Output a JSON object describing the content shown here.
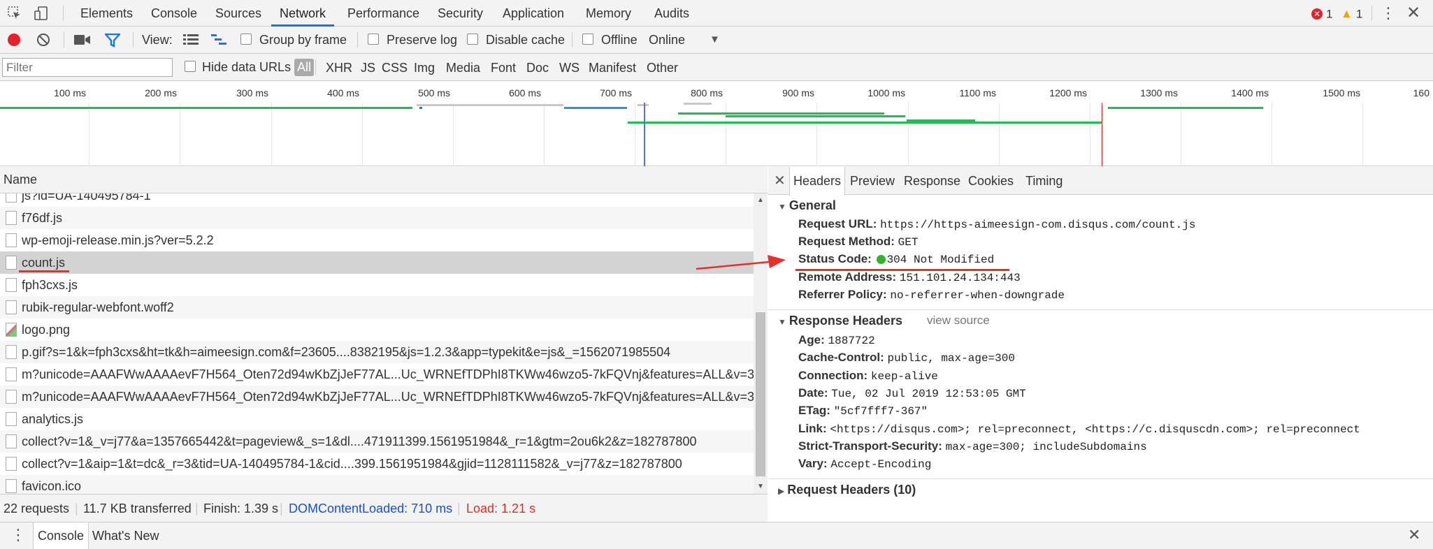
{
  "tabs": [
    "Elements",
    "Console",
    "Sources",
    "Network",
    "Performance",
    "Security",
    "Application",
    "Memory",
    "Audits"
  ],
  "active_tab": "Network",
  "errors": {
    "error_count": "1",
    "warning_count": "1"
  },
  "toolbar": {
    "view_label": "View:",
    "group_by_frame": "Group by frame",
    "preserve_log": "Preserve log",
    "disable_cache": "Disable cache",
    "offline": "Offline",
    "throttle": "Online"
  },
  "filter": {
    "placeholder": "Filter",
    "hide_data_urls": "Hide data URLs",
    "types": [
      "All",
      "XHR",
      "JS",
      "CSS",
      "Img",
      "Media",
      "Font",
      "Doc",
      "WS",
      "Manifest",
      "Other"
    ]
  },
  "timeline": {
    "ticks": [
      "100 ms",
      "200 ms",
      "300 ms",
      "400 ms",
      "500 ms",
      "600 ms",
      "700 ms",
      "800 ms",
      "900 ms",
      "1000 ms",
      "1100 ms",
      "1200 ms",
      "1300 ms",
      "1400 ms",
      "1500 ms",
      "160"
    ]
  },
  "list": {
    "header": "Name",
    "items": [
      "js?id=UA-140495784-1",
      "f76df.js",
      "wp-emoji-release.min.js?ver=5.2.2",
      "count.js",
      "fph3cxs.js",
      "rubik-regular-webfont.woff2",
      "logo.png",
      "p.gif?s=1&k=fph3cxs&ht=tk&h=aimeesign.com&f=23605....8382195&js=1.2.3&app=typekit&e=js&_=1562071985504",
      "m?unicode=AAAFWwAAAAevF7H564_Oten72d94wKbZjJeF77AL...Uc_WRNEfTDPhI8TKWw46wzo5-7kFQVnj&features=ALL&v=3",
      "m?unicode=AAAFWwAAAAevF7H564_Oten72d94wKbZjJeF77AL...Uc_WRNEfTDPhI8TKWw46wzo5-7kFQVnj&features=ALL&v=3",
      "analytics.js",
      "collect?v=1&_v=j77&a=1357665442&t=pageview&_s=1&dl....471911399.1561951984&_r=1&gtm=2ou6k2&z=182787800",
      "collect?v=1&aip=1&t=dc&_r=3&tid=UA-140495784-1&cid....399.1561951984&gjid=1128111582&_v=j77&z=182787800",
      "favicon.ico"
    ]
  },
  "status": {
    "requests": "22 requests",
    "transferred": "11.7 KB transferred",
    "finish": "Finish: 1.39 s",
    "dcl": "DOMContentLoaded: 710 ms",
    "load": "Load: 1.21 s"
  },
  "details": {
    "tabs": [
      "Headers",
      "Preview",
      "Response",
      "Cookies",
      "Timing"
    ],
    "general_title": "General",
    "general": [
      {
        "key": "Request URL:",
        "value": "https://https-aimeesign-com.disqus.com/count.js"
      },
      {
        "key": "Request Method:",
        "value": "GET"
      },
      {
        "key": "Status Code:",
        "value": "304 Not Modified"
      },
      {
        "key": "Remote Address:",
        "value": "151.101.24.134:443"
      },
      {
        "key": "Referrer Policy:",
        "value": "no-referrer-when-downgrade"
      }
    ],
    "response_title": "Response Headers",
    "view_source": "view source",
    "response": [
      {
        "key": "Age:",
        "value": "1887722"
      },
      {
        "key": "Cache-Control:",
        "value": "public, max-age=300"
      },
      {
        "key": "Connection:",
        "value": "keep-alive"
      },
      {
        "key": "Date:",
        "value": "Tue, 02 Jul 2019 12:53:05 GMT"
      },
      {
        "key": "ETag:",
        "value": "\"5cf7fff7-367\""
      },
      {
        "key": "Link:",
        "value": "<https://disqus.com>; rel=preconnect, <https://c.disquscdn.com>; rel=preconnect"
      },
      {
        "key": "Strict-Transport-Security:",
        "value": "max-age=300; includeSubdomains"
      },
      {
        "key": "Vary:",
        "value": "Accept-Encoding"
      }
    ],
    "request_title": "Request Headers (10)"
  },
  "drawer": {
    "tabs": [
      "Console",
      "What's New"
    ]
  },
  "colors": {
    "accent": "#1a73e8",
    "record": "#e8202a",
    "status_ok": "#2cb52c",
    "annotation": "#e8302a",
    "dcl": "#1a4fd6",
    "load": "#d93025"
  }
}
